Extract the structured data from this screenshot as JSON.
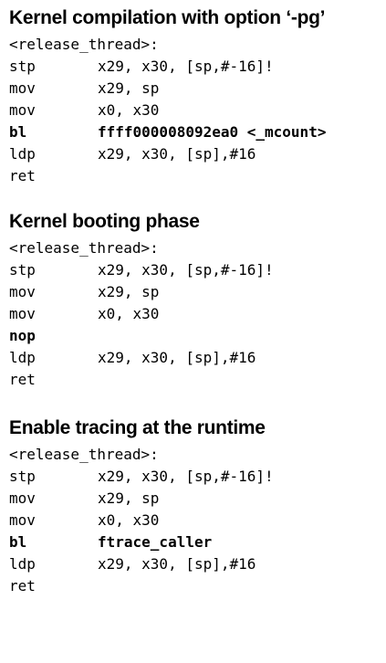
{
  "sections": [
    {
      "heading": "Kernel compilation with option ‘-pg’",
      "label": "<release_thread>:",
      "lines": [
        {
          "mnemonic": "stp",
          "operands": "x29, x30, [sp,#-16]!",
          "bold": false
        },
        {
          "mnemonic": "mov",
          "operands": "x29, sp",
          "bold": false
        },
        {
          "mnemonic": "mov",
          "operands": "x0, x30",
          "bold": false
        },
        {
          "mnemonic": "bl",
          "operands": "ffff000008092ea0 <_mcount>",
          "bold": true
        },
        {
          "mnemonic": "ldp",
          "operands": "x29, x30, [sp],#16",
          "bold": false
        },
        {
          "mnemonic": "ret",
          "operands": "",
          "bold": false
        }
      ]
    },
    {
      "heading": "Kernel booting phase",
      "label": "<release_thread>:",
      "lines": [
        {
          "mnemonic": "stp",
          "operands": "x29, x30, [sp,#-16]!",
          "bold": false
        },
        {
          "mnemonic": "mov",
          "operands": "x29, sp",
          "bold": false
        },
        {
          "mnemonic": "mov",
          "operands": "x0, x30",
          "bold": false
        },
        {
          "mnemonic": "nop",
          "operands": "",
          "bold": true
        },
        {
          "mnemonic": "ldp",
          "operands": "x29, x30, [sp],#16",
          "bold": false
        },
        {
          "mnemonic": "ret",
          "operands": "",
          "bold": false
        }
      ]
    },
    {
      "heading": "Enable tracing at the runtime",
      "label": "<release_thread>:",
      "lines": [
        {
          "mnemonic": "stp",
          "operands": "x29, x30, [sp,#-16]!",
          "bold": false
        },
        {
          "mnemonic": "mov",
          "operands": "x29, sp",
          "bold": false
        },
        {
          "mnemonic": "mov",
          "operands": "x0, x30",
          "bold": false
        },
        {
          "mnemonic": "bl",
          "operands": "ftrace_caller",
          "bold": true
        },
        {
          "mnemonic": "ldp",
          "operands": "x29, x30, [sp],#16",
          "bold": false
        },
        {
          "mnemonic": "ret",
          "operands": "",
          "bold": false
        }
      ]
    }
  ]
}
